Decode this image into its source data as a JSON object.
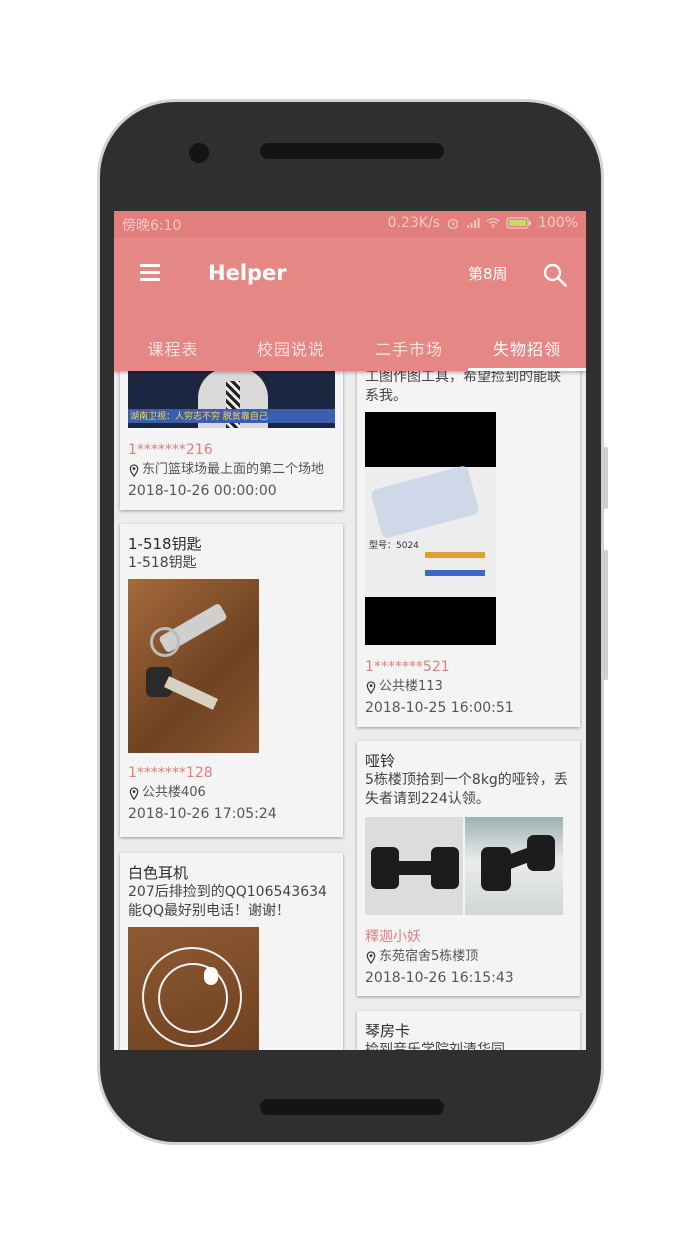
{
  "statusbar": {
    "time": "傍晚6:10",
    "net_speed": "0.23K/s",
    "battery": "100%"
  },
  "appbar": {
    "title": "Helper",
    "week": "第8周",
    "icons": [
      "menu-icon",
      "search-icon"
    ]
  },
  "tabs": [
    {
      "label": "课程表",
      "active": false
    },
    {
      "label": "校园说说",
      "active": false
    },
    {
      "label": "二手市场",
      "active": false
    },
    {
      "label": "失物招领",
      "active": true
    }
  ],
  "left_column": [
    {
      "title": "",
      "desc": "",
      "photo_caption": "湖南卫视：人穷志不穷 脱贫靠自己",
      "user": "1*******216",
      "location": "东门篮球场最上面的第二个场地",
      "time": "2018-10-26 00:00:00"
    },
    {
      "title": "1-518钥匙",
      "desc": "1-518钥匙",
      "user": "1*******128",
      "location": "公共楼406",
      "time": "2018-10-26 17:05:24"
    },
    {
      "title": "白色耳机",
      "desc": "207后排捡到的QQ106543634能QQ最好别电话！谢谢！"
    }
  ],
  "right_column": [
    {
      "desc": "工图作图工具，希望捡到的能联系我。",
      "photo_label": "型号：5024",
      "user": "1*******521",
      "location": "公共楼113",
      "time": "2018-10-25 16:00:51"
    },
    {
      "title": "哑铃",
      "desc": "5栋楼顶拾到一个8kg的哑铃，丢失者请到224认领。",
      "user": "釋迦小妖",
      "location": "东苑宿舍5栋楼顶",
      "time": "2018-10-26 16:15:43"
    },
    {
      "title": "琴房卡",
      "desc": "捡到音乐学院刘清华同"
    }
  ],
  "colors": {
    "primary": "#e58784",
    "status_bar": "#e27e7c",
    "accent_text": "#e07f7c",
    "card_bg": "#f4f4f4"
  }
}
